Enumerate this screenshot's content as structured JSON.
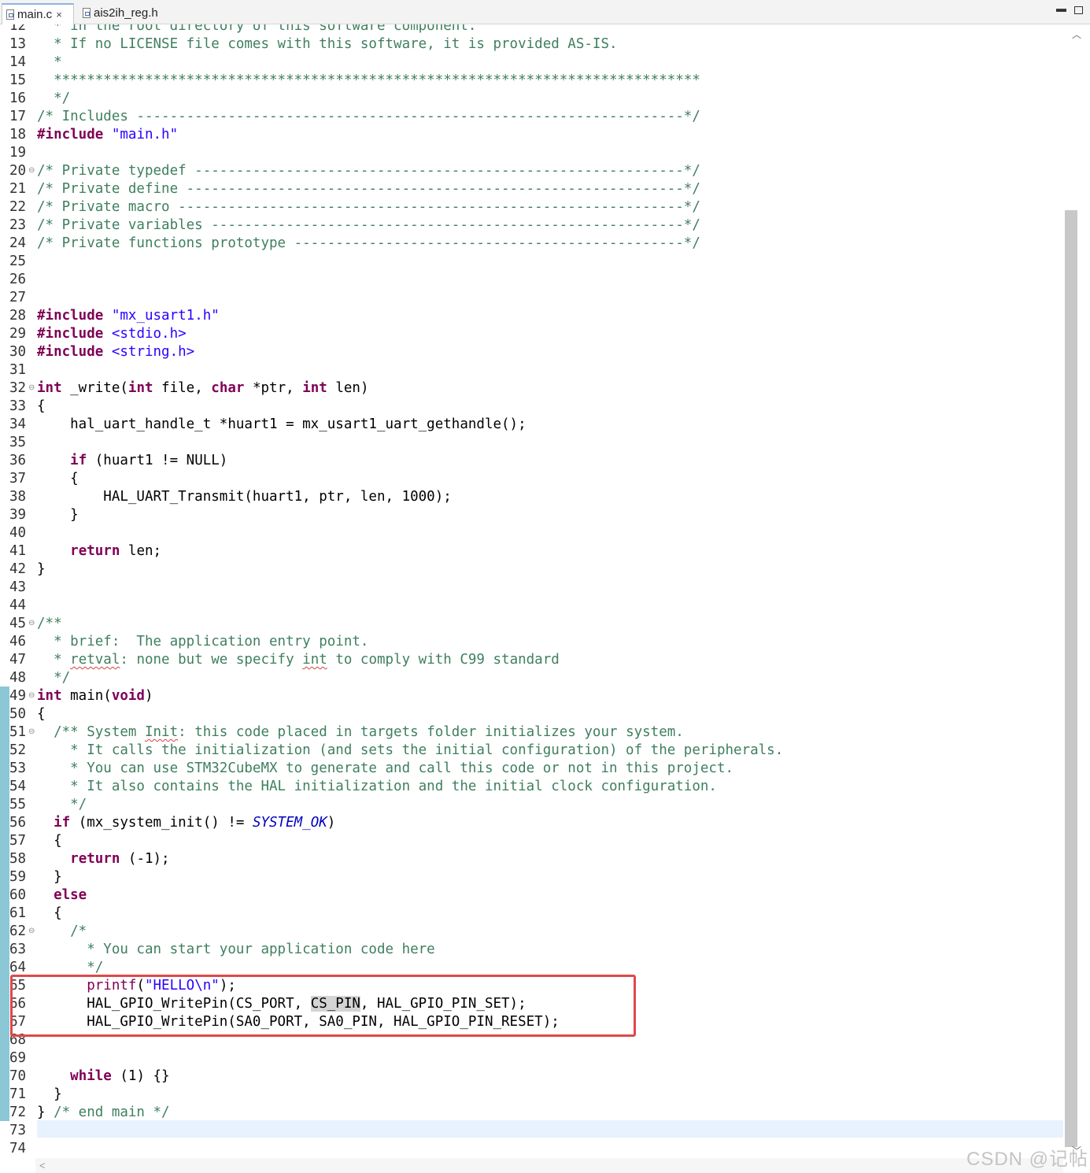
{
  "tabs": [
    {
      "label": "main.c",
      "active": true,
      "close": "×"
    },
    {
      "label": "ais2ih_reg.h",
      "active": false
    }
  ],
  "window_controls": {
    "minimize": "▬",
    "maximize": ""
  },
  "colors": {
    "comment": "#3f7f5f",
    "keyword": "#7f0055",
    "string": "#2a00ff",
    "macro": "#0000c0",
    "change_bar": "#8cc7d6",
    "highlight_box": "#e04848",
    "active_line": "#e8f2fe"
  },
  "icons": {
    "tab_file": "c-file-icon",
    "fold": "fold-minus-icon",
    "scroll_up": "chevron-up-icon",
    "scroll_down": "chevron-down-icon"
  },
  "fold_glyph": "⊖",
  "scroll_up_glyph": "︿",
  "scroll_down_glyph": "﹀",
  "scroll_left_glyph": "<",
  "watermark": "CSDN @记帖",
  "code_lines": [
    {
      "num": "12",
      "fold": false,
      "tokens": [
        {
          "t": "  * in the root directory of this software component.",
          "c": "comment"
        }
      ]
    },
    {
      "num": "13",
      "fold": false,
      "tokens": [
        {
          "t": "  * If no LICENSE file comes with this software, it is provided AS-IS.",
          "c": "comment"
        }
      ]
    },
    {
      "num": "14",
      "fold": false,
      "tokens": [
        {
          "t": "  *",
          "c": "comment"
        }
      ]
    },
    {
      "num": "15",
      "fold": false,
      "tokens": [
        {
          "t": "  ******************************************************************************",
          "c": "comment"
        }
      ]
    },
    {
      "num": "16",
      "fold": false,
      "tokens": [
        {
          "t": "  */",
          "c": "comment"
        }
      ]
    },
    {
      "num": "17",
      "fold": false,
      "tokens": [
        {
          "t": "/* Includes ------------------------------------------------------------------*/",
          "c": "comment"
        }
      ]
    },
    {
      "num": "18",
      "fold": false,
      "tokens": [
        {
          "t": "#include",
          "c": "kw"
        },
        {
          "t": " ",
          "c": "plain"
        },
        {
          "t": "\"main.h\"",
          "c": "str"
        }
      ]
    },
    {
      "num": "19",
      "fold": false,
      "tokens": []
    },
    {
      "num": "20",
      "fold": true,
      "tokens": [
        {
          "t": "/* Private typedef -----------------------------------------------------------*/",
          "c": "comment"
        }
      ]
    },
    {
      "num": "21",
      "fold": false,
      "tokens": [
        {
          "t": "/* Private define ------------------------------------------------------------*/",
          "c": "comment"
        }
      ]
    },
    {
      "num": "22",
      "fold": false,
      "tokens": [
        {
          "t": "/* Private macro -------------------------------------------------------------*/",
          "c": "comment"
        }
      ]
    },
    {
      "num": "23",
      "fold": false,
      "tokens": [
        {
          "t": "/* Private variables ---------------------------------------------------------*/",
          "c": "comment"
        }
      ]
    },
    {
      "num": "24",
      "fold": false,
      "tokens": [
        {
          "t": "/* Private functions prototype -----------------------------------------------*/",
          "c": "comment"
        }
      ]
    },
    {
      "num": "25",
      "fold": false,
      "tokens": []
    },
    {
      "num": "26",
      "fold": false,
      "tokens": []
    },
    {
      "num": "27",
      "fold": false,
      "tokens": []
    },
    {
      "num": "28",
      "fold": false,
      "tokens": [
        {
          "t": "#include",
          "c": "kw"
        },
        {
          "t": " ",
          "c": "plain"
        },
        {
          "t": "\"mx_usart1.h\"",
          "c": "str"
        }
      ]
    },
    {
      "num": "29",
      "fold": false,
      "tokens": [
        {
          "t": "#include",
          "c": "kw"
        },
        {
          "t": " ",
          "c": "plain"
        },
        {
          "t": "<stdio.h>",
          "c": "str"
        }
      ]
    },
    {
      "num": "30",
      "fold": false,
      "tokens": [
        {
          "t": "#include",
          "c": "kw"
        },
        {
          "t": " ",
          "c": "plain"
        },
        {
          "t": "<string.h>",
          "c": "str"
        }
      ]
    },
    {
      "num": "31",
      "fold": false,
      "tokens": []
    },
    {
      "num": "32",
      "fold": true,
      "tokens": [
        {
          "t": "int",
          "c": "kw"
        },
        {
          "t": " _write(",
          "c": "plain"
        },
        {
          "t": "int",
          "c": "kw"
        },
        {
          "t": " file, ",
          "c": "plain"
        },
        {
          "t": "char",
          "c": "kw"
        },
        {
          "t": " *ptr, ",
          "c": "plain"
        },
        {
          "t": "int",
          "c": "kw"
        },
        {
          "t": " len)",
          "c": "plain"
        }
      ]
    },
    {
      "num": "33",
      "fold": false,
      "tokens": [
        {
          "t": "{",
          "c": "plain"
        }
      ]
    },
    {
      "num": "34",
      "fold": false,
      "tokens": [
        {
          "t": "    hal_uart_handle_t *huart1 = mx_usart1_uart_gethandle();",
          "c": "plain"
        }
      ]
    },
    {
      "num": "35",
      "fold": false,
      "tokens": []
    },
    {
      "num": "36",
      "fold": false,
      "tokens": [
        {
          "t": "    ",
          "c": "plain"
        },
        {
          "t": "if",
          "c": "kw"
        },
        {
          "t": " (huart1 != NULL)",
          "c": "plain"
        }
      ]
    },
    {
      "num": "37",
      "fold": false,
      "tokens": [
        {
          "t": "    {",
          "c": "plain"
        }
      ]
    },
    {
      "num": "38",
      "fold": false,
      "tokens": [
        {
          "t": "        HAL_UART_Transmit(huart1, ptr, len, 1000);",
          "c": "plain"
        }
      ]
    },
    {
      "num": "39",
      "fold": false,
      "tokens": [
        {
          "t": "    }",
          "c": "plain"
        }
      ]
    },
    {
      "num": "40",
      "fold": false,
      "tokens": []
    },
    {
      "num": "41",
      "fold": false,
      "tokens": [
        {
          "t": "    ",
          "c": "plain"
        },
        {
          "t": "return",
          "c": "kw"
        },
        {
          "t": " len;",
          "c": "plain"
        }
      ]
    },
    {
      "num": "42",
      "fold": false,
      "tokens": [
        {
          "t": "}",
          "c": "plain"
        }
      ]
    },
    {
      "num": "43",
      "fold": false,
      "tokens": []
    },
    {
      "num": "44",
      "fold": false,
      "tokens": []
    },
    {
      "num": "45",
      "fold": true,
      "tokens": [
        {
          "t": "/**",
          "c": "comment"
        }
      ]
    },
    {
      "num": "46",
      "fold": false,
      "tokens": [
        {
          "t": "  * brief:  The application entry point.",
          "c": "comment"
        }
      ]
    },
    {
      "num": "47",
      "fold": false,
      "tokens": [
        {
          "t": "  * ",
          "c": "comment"
        },
        {
          "t": "retval",
          "c": "comment squig"
        },
        {
          "t": ": none but we specify ",
          "c": "comment"
        },
        {
          "t": "int",
          "c": "comment squig"
        },
        {
          "t": " to comply with C99 standard",
          "c": "comment"
        }
      ]
    },
    {
      "num": "48",
      "fold": false,
      "tokens": [
        {
          "t": "  */",
          "c": "comment"
        }
      ]
    },
    {
      "num": "49",
      "fold": true,
      "tokens": [
        {
          "t": "int",
          "c": "kw"
        },
        {
          "t": " main(",
          "c": "plain"
        },
        {
          "t": "void",
          "c": "kw"
        },
        {
          "t": ")",
          "c": "plain"
        }
      ]
    },
    {
      "num": "50",
      "fold": false,
      "tokens": [
        {
          "t": "{",
          "c": "plain"
        }
      ]
    },
    {
      "num": "51",
      "fold": true,
      "tokens": [
        {
          "t": "  /** System ",
          "c": "comment"
        },
        {
          "t": "Init",
          "c": "comment squig"
        },
        {
          "t": ": this code placed in targets folder initializes your system.",
          "c": "comment"
        }
      ]
    },
    {
      "num": "52",
      "fold": false,
      "tokens": [
        {
          "t": "    * It calls the initialization (and sets the initial configuration) of the peripherals.",
          "c": "comment"
        }
      ]
    },
    {
      "num": "53",
      "fold": false,
      "tokens": [
        {
          "t": "    * You can use STM32CubeMX to generate and call this code or not in this project.",
          "c": "comment"
        }
      ]
    },
    {
      "num": "54",
      "fold": false,
      "tokens": [
        {
          "t": "    * It also contains the HAL initialization and the initial clock configuration.",
          "c": "comment"
        }
      ]
    },
    {
      "num": "55",
      "fold": false,
      "tokens": [
        {
          "t": "    */",
          "c": "comment"
        }
      ]
    },
    {
      "num": "56",
      "fold": false,
      "tokens": [
        {
          "t": "  ",
          "c": "plain"
        },
        {
          "t": "if",
          "c": "kw"
        },
        {
          "t": " (mx_system_init() != ",
          "c": "plain"
        },
        {
          "t": "SYSTEM_OK",
          "c": "macro"
        },
        {
          "t": ")",
          "c": "plain"
        }
      ]
    },
    {
      "num": "57",
      "fold": false,
      "tokens": [
        {
          "t": "  {",
          "c": "plain"
        }
      ]
    },
    {
      "num": "58",
      "fold": false,
      "tokens": [
        {
          "t": "    ",
          "c": "plain"
        },
        {
          "t": "return",
          "c": "kw"
        },
        {
          "t": " (-1);",
          "c": "plain"
        }
      ]
    },
    {
      "num": "59",
      "fold": false,
      "tokens": [
        {
          "t": "  }",
          "c": "plain"
        }
      ]
    },
    {
      "num": "60",
      "fold": false,
      "tokens": [
        {
          "t": "  ",
          "c": "plain"
        },
        {
          "t": "else",
          "c": "kw"
        }
      ]
    },
    {
      "num": "61",
      "fold": false,
      "tokens": [
        {
          "t": "  {",
          "c": "plain"
        }
      ]
    },
    {
      "num": "62",
      "fold": true,
      "tokens": [
        {
          "t": "    /*",
          "c": "comment"
        }
      ]
    },
    {
      "num": "63",
      "fold": false,
      "tokens": [
        {
          "t": "      * You can start your application code here",
          "c": "comment"
        }
      ]
    },
    {
      "num": "64",
      "fold": false,
      "tokens": [
        {
          "t": "      */",
          "c": "comment"
        }
      ]
    },
    {
      "num": "65",
      "fold": false,
      "tokens": [
        {
          "t": "      ",
          "c": "plain"
        },
        {
          "t": "printf",
          "c": "kw-nb"
        },
        {
          "t": "(",
          "c": "plain"
        },
        {
          "t": "\"HELLO\\n\"",
          "c": "str"
        },
        {
          "t": ");",
          "c": "plain"
        }
      ]
    },
    {
      "num": "66",
      "fold": false,
      "tokens": [
        {
          "t": "      HAL_GPIO_WritePin(CS_PORT, ",
          "c": "plain"
        },
        {
          "t": "CS_PIN",
          "c": "plain hl"
        },
        {
          "t": ", HAL_GPIO_PIN_SET);",
          "c": "plain"
        }
      ]
    },
    {
      "num": "67",
      "fold": false,
      "tokens": [
        {
          "t": "      HAL_GPIO_WritePin(SA0_PORT, SA0_PIN, HAL_GPIO_PIN_RESET);",
          "c": "plain"
        }
      ]
    },
    {
      "num": "68",
      "fold": false,
      "tokens": []
    },
    {
      "num": "69",
      "fold": false,
      "tokens": []
    },
    {
      "num": "70",
      "fold": false,
      "tokens": [
        {
          "t": "    ",
          "c": "plain"
        },
        {
          "t": "while",
          "c": "kw"
        },
        {
          "t": " (1) {}",
          "c": "plain"
        }
      ]
    },
    {
      "num": "71",
      "fold": false,
      "tokens": [
        {
          "t": "  }",
          "c": "plain"
        }
      ]
    },
    {
      "num": "72",
      "fold": false,
      "tokens": [
        {
          "t": "} ",
          "c": "plain"
        },
        {
          "t": "/* end main */",
          "c": "comment"
        }
      ]
    },
    {
      "num": "73",
      "fold": false,
      "tokens": []
    },
    {
      "num": "74",
      "fold": false,
      "tokens": []
    }
  ]
}
